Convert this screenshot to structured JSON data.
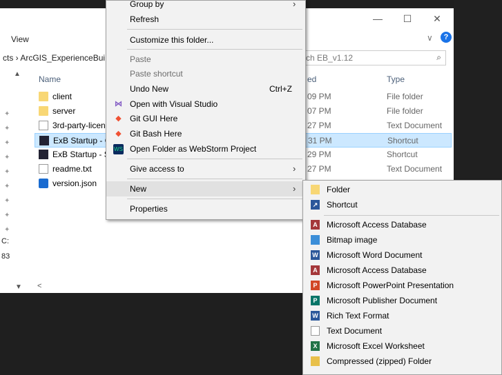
{
  "window": {
    "ribbon_tab": "View",
    "minimize": "—",
    "maximize": "☐",
    "close": "✕",
    "expand": "∨",
    "help": "?"
  },
  "address": {
    "breadcrumb": "cts  ›  ArcGIS_ExperienceBui",
    "search_value": "ch EB_v1.12",
    "search_icon": "search-icon"
  },
  "columns": {
    "name": "Name",
    "date": "ed",
    "type": "Type"
  },
  "files": [
    {
      "name": "client",
      "date": "09 PM",
      "type": "File folder",
      "icon": "folder-icon"
    },
    {
      "name": "server",
      "date": "07 PM",
      "type": "File folder",
      "icon": "folder-icon"
    },
    {
      "name": "3rd-party-licen",
      "date": "27 PM",
      "type": "Text Document",
      "icon": "text-file-icon"
    },
    {
      "name": "ExB Startup - C",
      "date": "31 PM",
      "type": "Shortcut",
      "icon": "shortcut-icon"
    },
    {
      "name": "ExB Startup - S",
      "date": "29 PM",
      "type": "Shortcut",
      "icon": "shortcut-icon"
    },
    {
      "name": "readme.txt",
      "date": "27 PM",
      "type": "Text Document",
      "icon": "text-file-icon"
    },
    {
      "name": "version.json",
      "date": "",
      "type": "",
      "icon": "vscode-json-icon"
    }
  ],
  "navpane": {
    "text1": "C:",
    "text2": "83"
  },
  "context_menu": {
    "items": [
      {
        "label": "Group by",
        "arrow": "›"
      },
      {
        "label": "Refresh"
      },
      {
        "label": "Customize this folder..."
      },
      {
        "label": "Paste",
        "disabled": true
      },
      {
        "label": "Paste shortcut",
        "disabled": true
      },
      {
        "label": "Undo New",
        "shortcut": "Ctrl+Z"
      },
      {
        "label": "Open with Visual Studio"
      },
      {
        "label": "Git GUI Here"
      },
      {
        "label": "Git Bash Here"
      },
      {
        "label": "Open Folder as WebStorm Project"
      },
      {
        "label": "Give access to",
        "arrow": "›"
      },
      {
        "label": "New",
        "arrow": "›"
      },
      {
        "label": "Properties"
      }
    ]
  },
  "new_submenu": {
    "items": [
      {
        "label": "Folder",
        "icon": "folder-icon",
        "color": "#f8d775"
      },
      {
        "label": "Shortcut",
        "icon": "shortcut-icon",
        "color": "#2b579a"
      },
      {
        "label": "Microsoft Access Database",
        "icon": "access-icon",
        "color": "#a4373a"
      },
      {
        "label": "Bitmap image",
        "icon": "bitmap-icon",
        "color": "#3b8ed8"
      },
      {
        "label": "Microsoft Word Document",
        "icon": "word-icon",
        "color": "#2b579a"
      },
      {
        "label": "Microsoft Access Database",
        "icon": "access-icon",
        "color": "#a4373a"
      },
      {
        "label": "Microsoft PowerPoint Presentation",
        "icon": "powerpoint-icon",
        "color": "#d24726"
      },
      {
        "label": "Microsoft Publisher Document",
        "icon": "publisher-icon",
        "color": "#077568"
      },
      {
        "label": "Rich Text Format",
        "icon": "rtf-icon",
        "color": "#2b579a"
      },
      {
        "label": "Text Document",
        "icon": "text-file-icon",
        "color": "#999999"
      },
      {
        "label": "Microsoft Excel Worksheet",
        "icon": "excel-icon",
        "color": "#217346"
      },
      {
        "label": "Compressed (zipped) Folder",
        "icon": "zip-folder-icon",
        "color": "#e8c04a"
      }
    ]
  }
}
